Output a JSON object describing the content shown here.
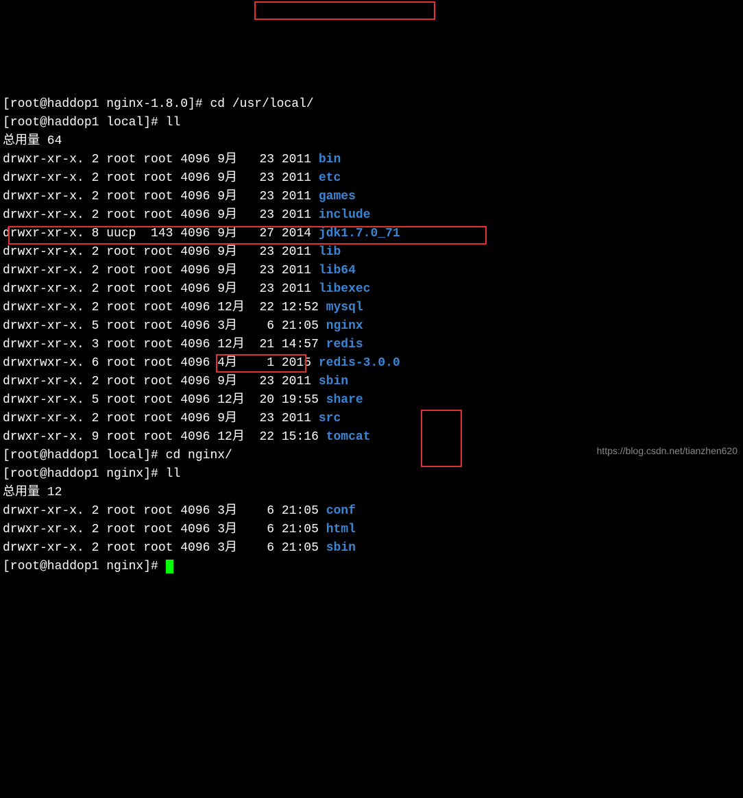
{
  "prompts": {
    "p1": "[root@haddop1 nginx-1.8.0]# ",
    "p2": "[root@haddop1 local]# ",
    "p3": "[root@haddop1 nginx]# "
  },
  "commands": {
    "cd_local": "cd /usr/local/",
    "ll": "ll",
    "cd_nginx": "cd nginx/"
  },
  "total1": "总用量 64",
  "total2": "总用量 12",
  "listing1": [
    {
      "perm": "drwxr-xr-x.",
      "links": " 2",
      "owner": "root",
      "group": "root",
      "size": "4096",
      "month": "9月 ",
      "day": " 23",
      "time": "2011",
      "name": "bin"
    },
    {
      "perm": "drwxr-xr-x.",
      "links": " 2",
      "owner": "root",
      "group": "root",
      "size": "4096",
      "month": "9月 ",
      "day": " 23",
      "time": "2011",
      "name": "etc"
    },
    {
      "perm": "drwxr-xr-x.",
      "links": " 2",
      "owner": "root",
      "group": "root",
      "size": "4096",
      "month": "9月 ",
      "day": " 23",
      "time": "2011",
      "name": "games"
    },
    {
      "perm": "drwxr-xr-x.",
      "links": " 2",
      "owner": "root",
      "group": "root",
      "size": "4096",
      "month": "9月 ",
      "day": " 23",
      "time": "2011",
      "name": "include"
    },
    {
      "perm": "drwxr-xr-x.",
      "links": " 8",
      "owner": "uucp",
      "group": " 143",
      "size": "4096",
      "month": "9月 ",
      "day": " 27",
      "time": "2014",
      "name": "jdk1.7.0_71"
    },
    {
      "perm": "drwxr-xr-x.",
      "links": " 2",
      "owner": "root",
      "group": "root",
      "size": "4096",
      "month": "9月 ",
      "day": " 23",
      "time": "2011",
      "name": "lib"
    },
    {
      "perm": "drwxr-xr-x.",
      "links": " 2",
      "owner": "root",
      "group": "root",
      "size": "4096",
      "month": "9月 ",
      "day": " 23",
      "time": "2011",
      "name": "lib64"
    },
    {
      "perm": "drwxr-xr-x.",
      "links": " 2",
      "owner": "root",
      "group": "root",
      "size": "4096",
      "month": "9月 ",
      "day": " 23",
      "time": "2011",
      "name": "libexec"
    },
    {
      "perm": "drwxr-xr-x.",
      "links": " 2",
      "owner": "root",
      "group": "root",
      "size": "4096",
      "month": "12月",
      "day": " 22",
      "time": "12:52",
      "name": "mysql"
    },
    {
      "perm": "drwxr-xr-x.",
      "links": " 5",
      "owner": "root",
      "group": "root",
      "size": "4096",
      "month": "3月 ",
      "day": "  6",
      "time": "21:05",
      "name": "nginx"
    },
    {
      "perm": "drwxr-xr-x.",
      "links": " 3",
      "owner": "root",
      "group": "root",
      "size": "4096",
      "month": "12月",
      "day": " 21",
      "time": "14:57",
      "name": "redis"
    },
    {
      "perm": "drwxrwxr-x.",
      "links": " 6",
      "owner": "root",
      "group": "root",
      "size": "4096",
      "month": "4月 ",
      "day": "  1",
      "time": "2015",
      "name": "redis-3.0.0"
    },
    {
      "perm": "drwxr-xr-x.",
      "links": " 2",
      "owner": "root",
      "group": "root",
      "size": "4096",
      "month": "9月 ",
      "day": " 23",
      "time": "2011",
      "name": "sbin"
    },
    {
      "perm": "drwxr-xr-x.",
      "links": " 5",
      "owner": "root",
      "group": "root",
      "size": "4096",
      "month": "12月",
      "day": " 20",
      "time": "19:55",
      "name": "share"
    },
    {
      "perm": "drwxr-xr-x.",
      "links": " 2",
      "owner": "root",
      "group": "root",
      "size": "4096",
      "month": "9月 ",
      "day": " 23",
      "time": "2011",
      "name": "src"
    },
    {
      "perm": "drwxr-xr-x.",
      "links": " 9",
      "owner": "root",
      "group": "root",
      "size": "4096",
      "month": "12月",
      "day": " 22",
      "time": "15:16",
      "name": "tomcat"
    }
  ],
  "listing2": [
    {
      "perm": "drwxr-xr-x.",
      "links": " 2",
      "owner": "root",
      "group": "root",
      "size": "4096",
      "month": "3月 ",
      "day": "  6",
      "time": "21:05",
      "name": "conf"
    },
    {
      "perm": "drwxr-xr-x.",
      "links": " 2",
      "owner": "root",
      "group": "root",
      "size": "4096",
      "month": "3月 ",
      "day": "  6",
      "time": "21:05",
      "name": "html"
    },
    {
      "perm": "drwxr-xr-x.",
      "links": " 2",
      "owner": "root",
      "group": "root",
      "size": "4096",
      "month": "3月 ",
      "day": "  6",
      "time": "21:05",
      "name": "sbin"
    }
  ],
  "watermark": "https://blog.csdn.net/tianzhen620"
}
